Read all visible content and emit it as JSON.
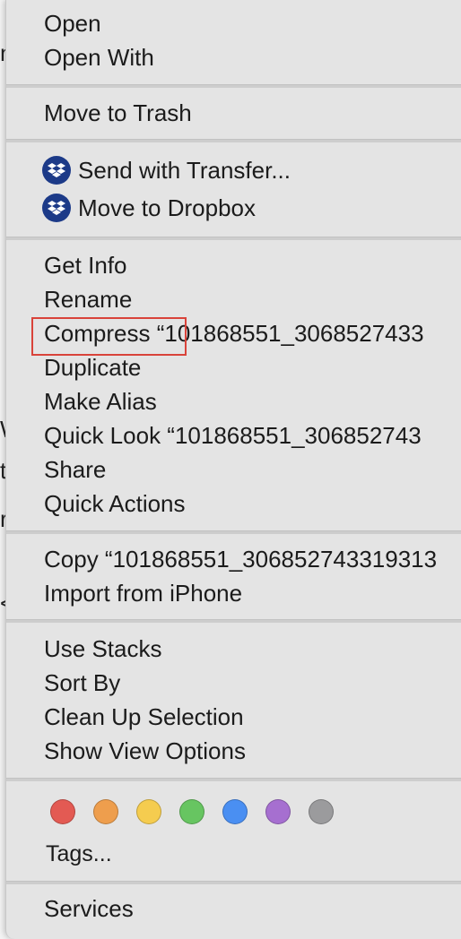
{
  "menu": {
    "groups": [
      {
        "items": [
          {
            "label": "Open"
          },
          {
            "label": "Open With"
          }
        ]
      },
      {
        "items": [
          {
            "label": "Move to Trash"
          }
        ]
      },
      {
        "items": [
          {
            "label": "Send with Transfer...",
            "icon": "dropbox-icon"
          },
          {
            "label": "Move to Dropbox",
            "icon": "dropbox-icon"
          }
        ]
      },
      {
        "items": [
          {
            "label": "Get Info"
          },
          {
            "label": "Rename"
          },
          {
            "label": "Compress “101868551_3068527433"
          },
          {
            "label": "Duplicate"
          },
          {
            "label": "Make Alias"
          },
          {
            "label": "Quick Look “101868551_306852743"
          },
          {
            "label": "Share"
          },
          {
            "label": "Quick Actions"
          }
        ]
      },
      {
        "items": [
          {
            "label": "Copy “101868551_306852743319313"
          },
          {
            "label": "Import from iPhone"
          }
        ]
      },
      {
        "items": [
          {
            "label": "Use Stacks"
          },
          {
            "label": "Sort By"
          },
          {
            "label": "Clean Up Selection"
          },
          {
            "label": "Show View Options"
          }
        ]
      },
      {
        "tag_colors": [
          "#e35a53",
          "#ee9e4d",
          "#f5cc4f",
          "#67c561",
          "#4a8ff2",
          "#a66fd0",
          "#9b9b9d"
        ],
        "tags_label": "Tags..."
      },
      {
        "items": [
          {
            "label": "Services"
          }
        ]
      }
    ]
  },
  "background_stubs": [
    "n",
    "W",
    "t",
    "r",
    "<"
  ]
}
